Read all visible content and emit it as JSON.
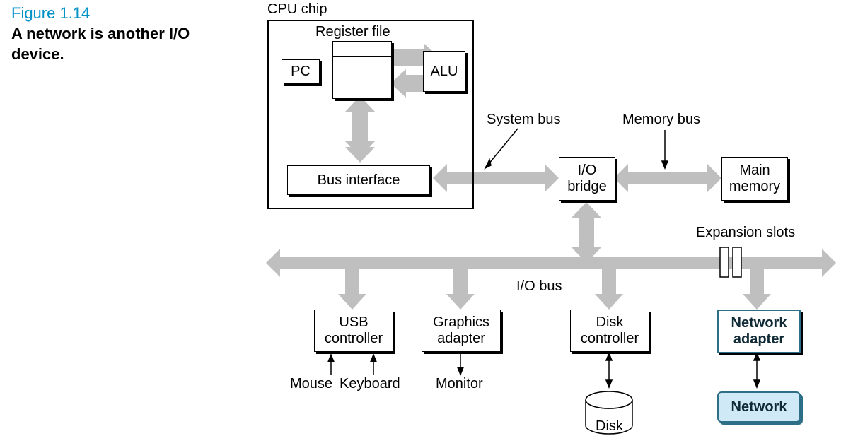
{
  "figure": {
    "number": "Figure 1.14",
    "caption": "A network is another I/O\ndevice."
  },
  "diagram": {
    "cpu_chip_label": "CPU chip",
    "register_file_label": "Register file",
    "pc": "PC",
    "alu": "ALU",
    "bus_interface": "Bus interface",
    "system_bus": "System bus",
    "memory_bus": "Memory bus",
    "io_bridge": "I/O\nbridge",
    "main_memory": "Main\nmemory",
    "expansion_slots": "Expansion slots",
    "io_bus": "I/O bus",
    "usb_controller": "USB\ncontroller",
    "graphics_adapter": "Graphics\nadapter",
    "disk_controller": "Disk\ncontroller",
    "network_adapter": "Network\nadapter",
    "mouse": "Mouse",
    "keyboard": "Keyboard",
    "monitor": "Monitor",
    "disk": "Disk",
    "network": "Network"
  }
}
